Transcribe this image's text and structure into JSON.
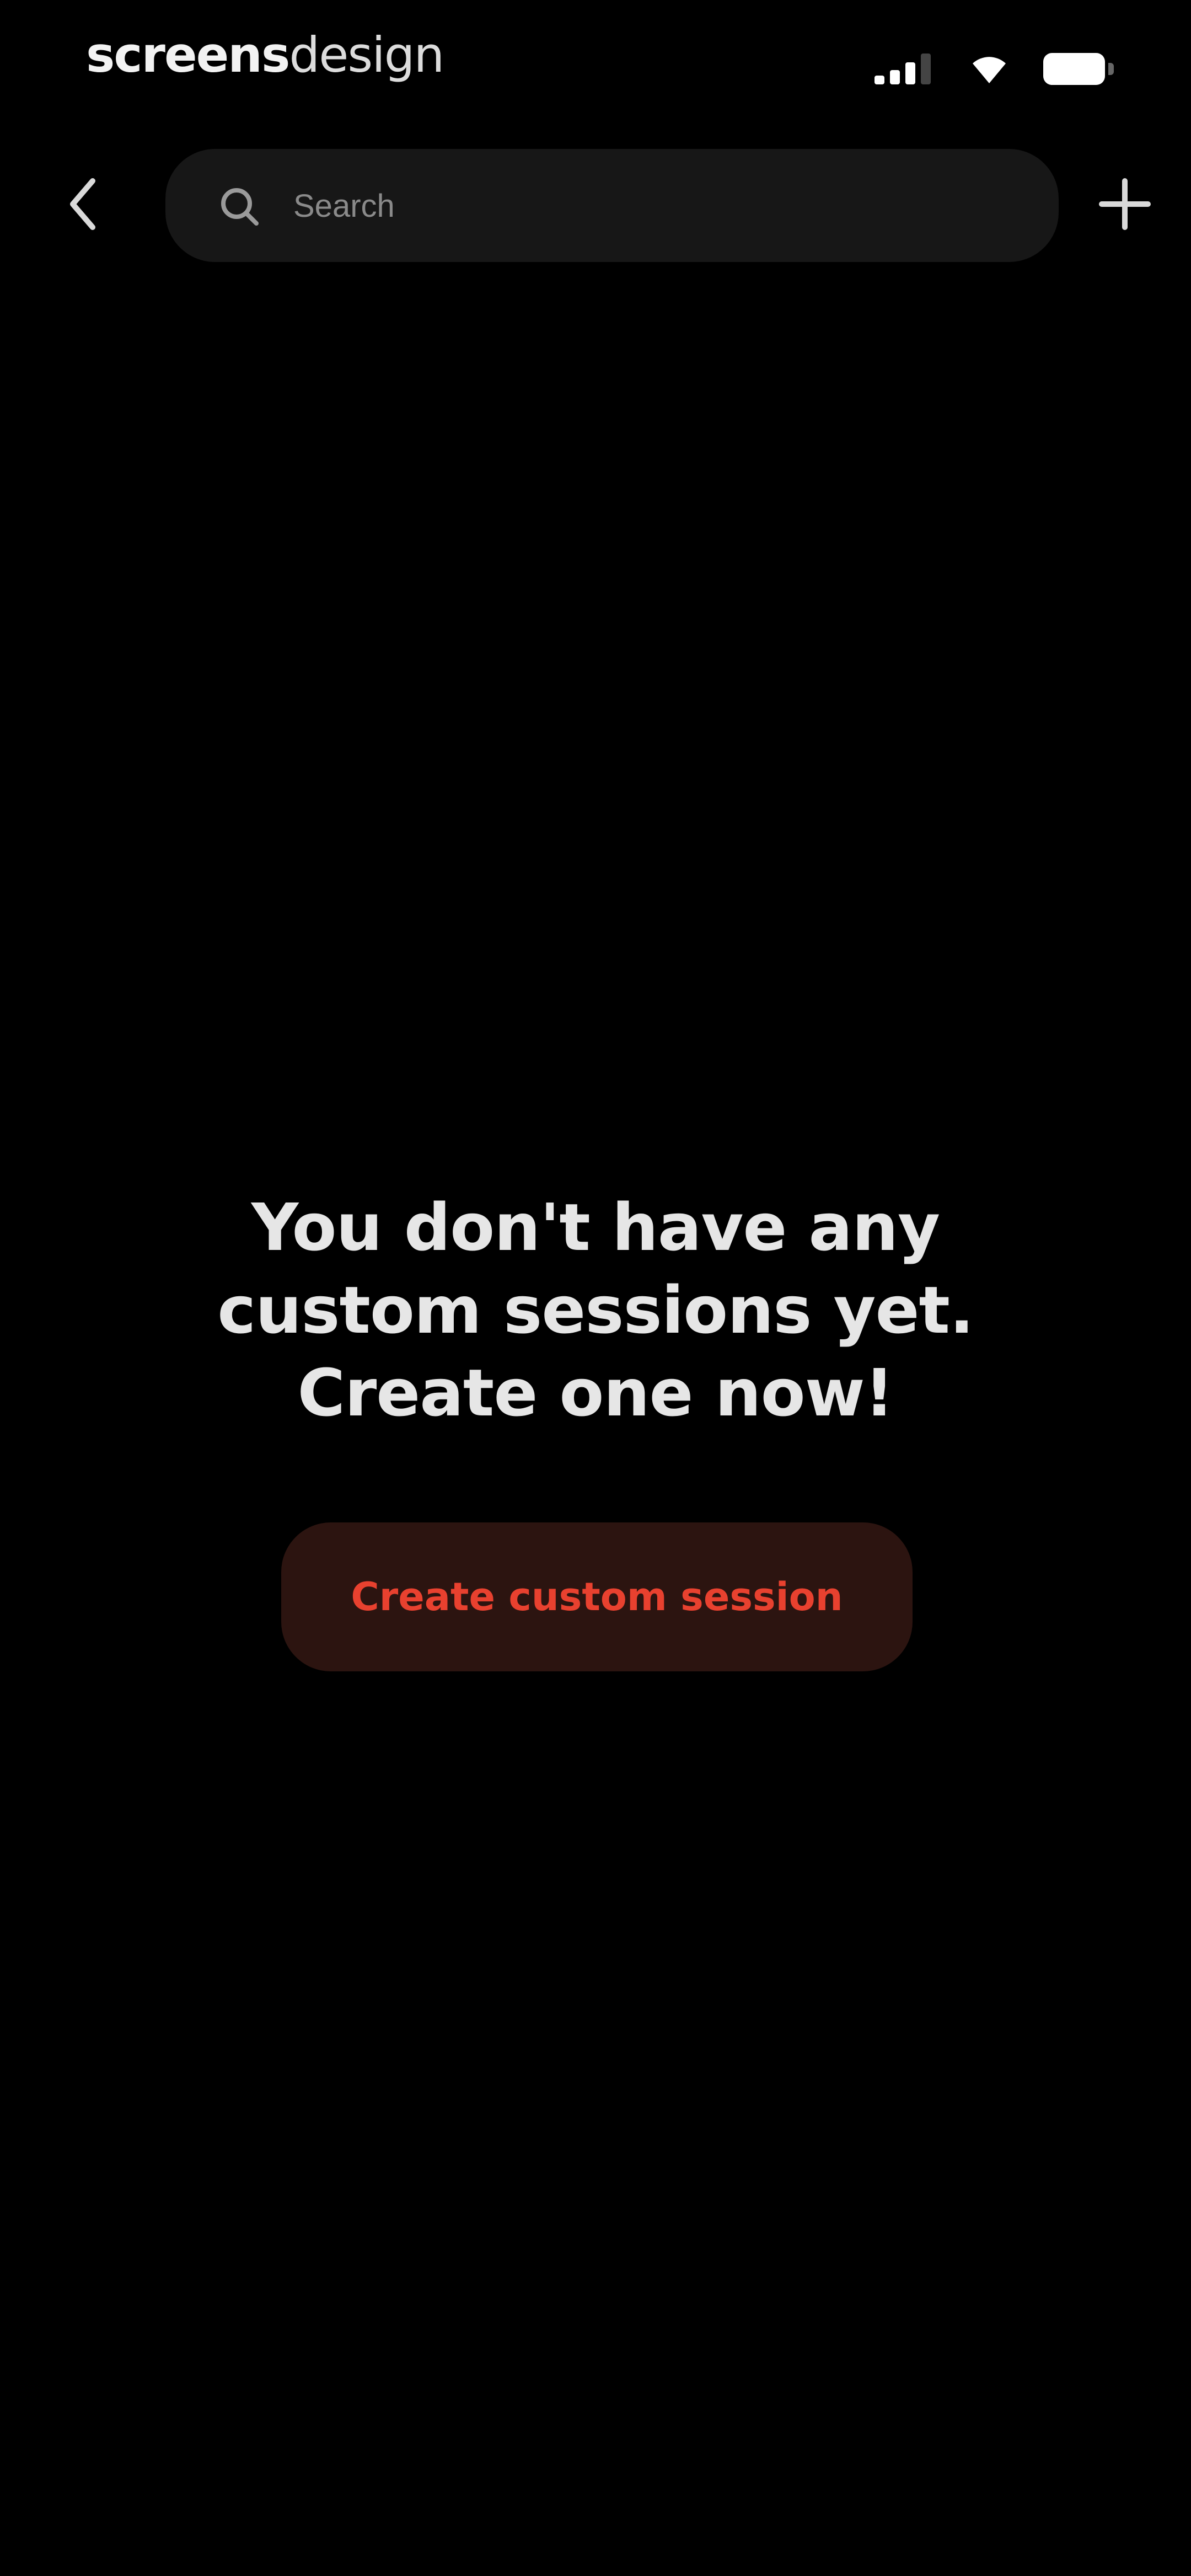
{
  "status_bar": {
    "brand_bold": "screens",
    "brand_light": "design",
    "icons": [
      "cellular-signal-icon",
      "wifi-icon",
      "battery-icon"
    ]
  },
  "header": {
    "back_icon": "chevron-left-icon",
    "search": {
      "placeholder": "Search",
      "value": "",
      "icon": "search-icon"
    },
    "add_icon": "plus-icon"
  },
  "empty_state": {
    "message_lines": [
      "You don't have any",
      "custom sessions yet.",
      "Create one now!"
    ],
    "button_label": "Create custom session"
  },
  "colors": {
    "background": "#000000",
    "search_field": "#171717",
    "accent": "#e8412f",
    "button_background": "#2c1410",
    "text_primary": "#e6e6e6"
  }
}
